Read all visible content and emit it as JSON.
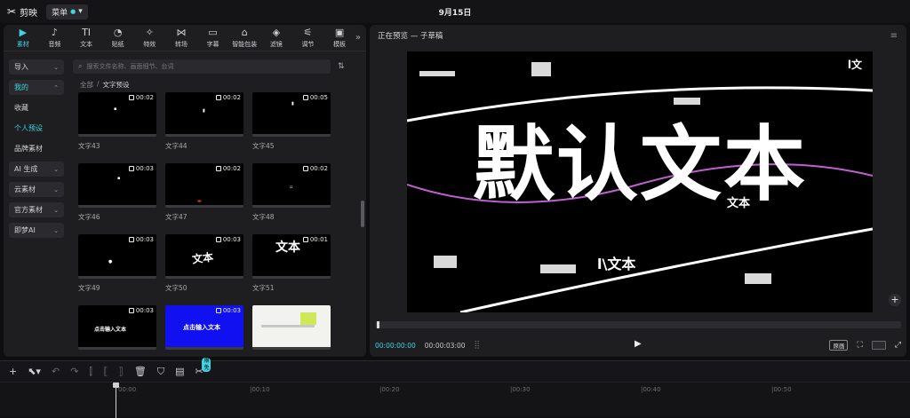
{
  "titlebar": {
    "app_name": "剪映",
    "menu_label": "菜单",
    "project_title": "9月15日"
  },
  "tool_tabs": [
    {
      "label": "素材",
      "icon": "media-icon"
    },
    {
      "label": "音频",
      "icon": "audio-icon"
    },
    {
      "label": "文本",
      "icon": "text-icon"
    },
    {
      "label": "贴纸",
      "icon": "sticker-icon"
    },
    {
      "label": "特效",
      "icon": "effects-icon"
    },
    {
      "label": "转场",
      "icon": "transition-icon"
    },
    {
      "label": "字幕",
      "icon": "subtitle-icon"
    },
    {
      "label": "智能包装",
      "icon": "smart-pack-icon"
    },
    {
      "label": "滤镜",
      "icon": "filter-icon"
    },
    {
      "label": "调节",
      "icon": "adjust-icon"
    },
    {
      "label": "模板",
      "icon": "template-icon"
    }
  ],
  "sidebar": {
    "items": [
      {
        "label": "导入"
      },
      {
        "label": "我的"
      },
      {
        "label": "收藏"
      },
      {
        "label": "个人预设"
      },
      {
        "label": "品牌素材"
      },
      {
        "label": "AI 生成"
      },
      {
        "label": "云素材"
      },
      {
        "label": "官方素材"
      },
      {
        "label": "即梦AI"
      }
    ]
  },
  "search": {
    "placeholder": "搜索文件名称、画面细节、台词"
  },
  "breadcrumb": {
    "root": "全部",
    "current": "文字预设"
  },
  "cards": [
    {
      "caption": "文字43",
      "duration": "00:02"
    },
    {
      "caption": "文字44",
      "duration": "00:02"
    },
    {
      "caption": "文字45",
      "duration": "00:05"
    },
    {
      "caption": "文字46",
      "duration": "00:03"
    },
    {
      "caption": "文字47",
      "duration": "00:02"
    },
    {
      "caption": "文字48",
      "duration": "00:02"
    },
    {
      "caption": "文字49",
      "duration": "00:03"
    },
    {
      "caption": "文字50",
      "duration": "00:03"
    },
    {
      "caption": "文字51",
      "duration": "00:01"
    },
    {
      "caption": "",
      "duration": "00:03",
      "thumb_text": "点击输入文本"
    },
    {
      "caption": "",
      "duration": "00:03",
      "thumb_text": "点击输入文本"
    },
    {
      "caption": "",
      "duration": ""
    }
  ],
  "card_thumb_text": {
    "wenben": "文本"
  },
  "preview": {
    "header": "正在预览 — 子草稿",
    "big_text": "默认文本",
    "small_text": "l\\文本",
    "corner_text": "l文",
    "mid_text": "文本",
    "current_time": "00:00:00:00",
    "total_time": "00:00:03:00",
    "ratio_label": "原画"
  },
  "timeline": {
    "badge": "限免",
    "ticks": [
      "00:00",
      "|00:10",
      "|00:20",
      "|00:30",
      "|00:40",
      "|00:50"
    ]
  },
  "colors": {
    "accent": "#3fd3e0",
    "blue_card": "#1010f0"
  }
}
